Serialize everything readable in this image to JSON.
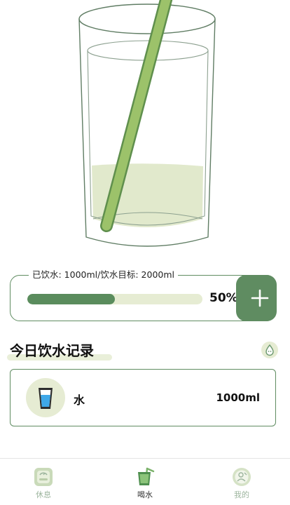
{
  "progress": {
    "legend": "已饮水: 1000ml/饮水目标: 2000ml",
    "fraction": 0.5,
    "percent_text": "50%"
  },
  "records": {
    "title": "今日饮水记录",
    "items": [
      {
        "name": "水",
        "amount": "1000ml",
        "icon": "water-cup-icon"
      }
    ]
  },
  "nav": {
    "items": [
      {
        "label": "休息",
        "icon": "scale-icon",
        "active": false
      },
      {
        "label": "喝水",
        "icon": "drink-cup-icon",
        "active": true
      },
      {
        "label": "我的",
        "icon": "profile-icon",
        "active": false
      }
    ]
  },
  "colors": {
    "primary": "#5f8c61",
    "light_green": "#e6ecd3",
    "straw": "#9cc26a"
  }
}
